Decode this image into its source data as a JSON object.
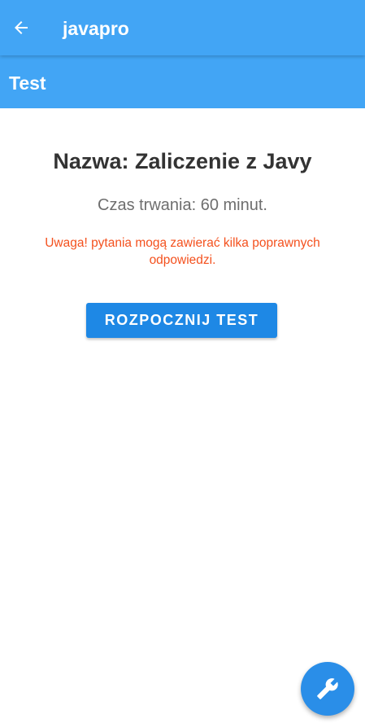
{
  "app_bar": {
    "title": "javapro",
    "back_icon": "arrow-back-icon",
    "background": "#42a5f5"
  },
  "sub_bar": {
    "title": "Test"
  },
  "test": {
    "name": "Nazwa: Zaliczenie z Javy",
    "duration": "Czas trwania: 60 minut.",
    "warning": "Uwaga! pytania mogą zawierać kilka poprawnych odpowiedzi.",
    "start_label": "ROZPOCZNIJ TEST",
    "warning_color": "#f4511e",
    "button_color": "#1e88e5"
  },
  "fab": {
    "icon": "wrench-icon",
    "color": "#2a8ee8"
  }
}
